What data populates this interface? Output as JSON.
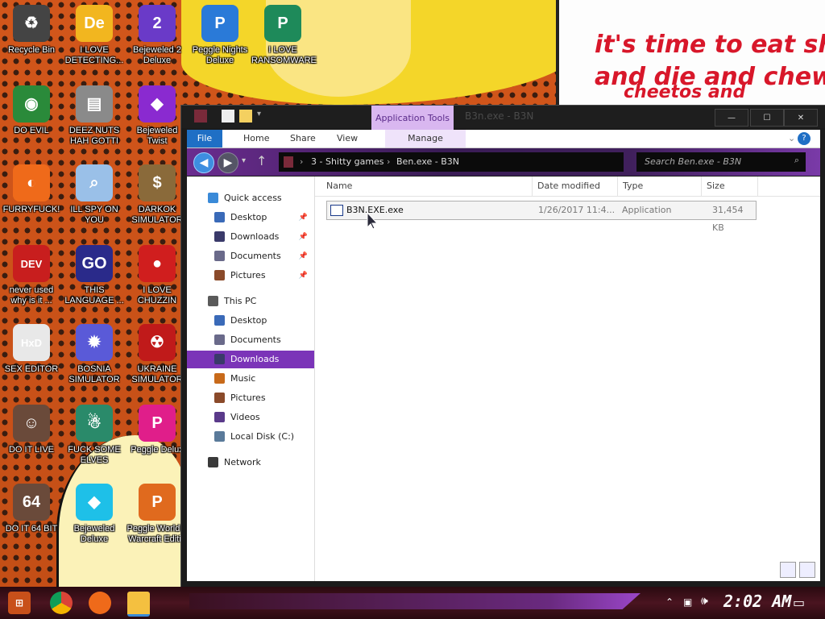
{
  "desktop": {
    "meme_lines": [
      "it's time to eat shit",
      "and die and chew",
      "cheetos and"
    ],
    "icons": [
      {
        "label": "Recycle Bin",
        "icon": "recycle-bin-icon",
        "color": "#444444",
        "glyph": "♻"
      },
      {
        "label": "I LOVE\nDETECTING...",
        "icon": "detect-it-easy-icon",
        "color": "#f2b61f",
        "glyph": "De"
      },
      {
        "label": "Bejeweled 2\nDeluxe",
        "icon": "bejeweled-2-icon",
        "color": "#6a3ac8",
        "glyph": "2"
      },
      {
        "label": "Peggle Nights\nDeluxe",
        "icon": "peggle-nights-icon",
        "color": "#2a7ad8",
        "glyph": "P"
      },
      {
        "label": "I LOVE\nRANSOMWARE",
        "icon": "ransomware-icon",
        "color": "#1e8a5a",
        "glyph": "P"
      },
      {
        "label": "DO EVIL",
        "icon": "chrome-icon",
        "color": "#2a8a3a",
        "glyph": "◉"
      },
      {
        "label": "DEEZ NUTS\nHAH GOTTI",
        "icon": "stack-windows-icon",
        "color": "#8a8a8a",
        "glyph": "▤"
      },
      {
        "label": "Bejeweled\nTwist",
        "icon": "bejeweled-twist-icon",
        "color": "#8a2ad0",
        "glyph": "◆"
      },
      {
        "label": "FURRYFUCK!",
        "icon": "firefox-icon",
        "color": "#ef6a1a",
        "glyph": "◐"
      },
      {
        "label": "ILL SPY ON\nYOU",
        "icon": "spy-icon",
        "color": "#9ac0e8",
        "glyph": "⌕"
      },
      {
        "label": "DARKOK\nSIMULATOR",
        "icon": "money-bag-icon",
        "color": "#8a6a3a",
        "glyph": "$"
      },
      {
        "label": "never used\nwhy is it ...",
        "icon": "devcpp-icon",
        "color": "#c81e1e",
        "glyph": "DEV"
      },
      {
        "label": "THIS\nLANGUAGE ...",
        "icon": "goland-icon",
        "color": "#2a2a8a",
        "glyph": "GO"
      },
      {
        "label": "I LOVE\nCHUZZIN",
        "icon": "chuzzle-icon",
        "color": "#d01e1e",
        "glyph": "●"
      },
      {
        "label": "SEX EDITOR",
        "icon": "hxd-icon",
        "color": "#e8e8e8",
        "glyph": "HxD"
      },
      {
        "label": "BOSNIA\nSIMULATOR",
        "icon": "virus-icon",
        "color": "#5a5ad8",
        "glyph": "✹"
      },
      {
        "label": "UKRAINE\nSIMULATOR",
        "icon": "radiation-icon",
        "color": "#c01a1a",
        "glyph": "☢"
      },
      {
        "label": "DO IT LIVE",
        "icon": "portrait-icon",
        "color": "#6a4a3a",
        "glyph": "☺"
      },
      {
        "label": "FUCK SOME\nELVES",
        "icon": "elf-icon",
        "color": "#2a8a6a",
        "glyph": "☃"
      },
      {
        "label": "Peggle Delux",
        "icon": "peggle-deluxe-icon",
        "color": "#e01e8a",
        "glyph": "P"
      },
      {
        "label": "DO IT 64 BIT",
        "icon": "portrait-64-icon",
        "color": "#6a4a3a",
        "glyph": "64"
      },
      {
        "label": "Bejeweled\nDeluxe",
        "icon": "bejeweled-deluxe-icon",
        "color": "#1ec0e8",
        "glyph": "◆"
      },
      {
        "label": "Peggle World o\nWarcraft Editio",
        "icon": "peggle-wow-icon",
        "color": "#e06a1e",
        "glyph": "P"
      }
    ]
  },
  "window": {
    "title": "B3n.exe - B3N",
    "contextual_tab": "Application Tools",
    "ribbon_tabs": [
      "File",
      "Home",
      "Share",
      "View",
      "Manage"
    ],
    "address_path": [
      "3 - Shitty games",
      "Ben.exe - B3N"
    ],
    "search_placeholder": "Search Ben.exe - B3N",
    "controls": {
      "minimize": "—",
      "maximize": "☐",
      "close": "✕"
    }
  },
  "navpane": {
    "quick_access": "Quick access",
    "quick_items": [
      "Desktop",
      "Downloads",
      "Documents",
      "Pictures"
    ],
    "this_pc": "This PC",
    "pc_items": [
      "Desktop",
      "Documents",
      "Downloads",
      "Music",
      "Pictures",
      "Videos",
      "Local Disk (C:)"
    ],
    "network": "Network"
  },
  "filelist": {
    "columns": [
      "Name",
      "Date modified",
      "Type",
      "Size"
    ],
    "rows": [
      {
        "name": "B3N.EXE.exe",
        "date": "1/26/2017 11:4...",
        "type": "Application",
        "size": "31,454 KB"
      }
    ]
  },
  "taskbar": {
    "clock": "2:02 AM",
    "apps": [
      "start-icon",
      "chrome-icon",
      "firefox-icon",
      "file-explorer-icon"
    ]
  },
  "colors": {
    "accent": "#7b34b8",
    "file_tab": "#1f6fc5",
    "meme_text": "#d8172a"
  }
}
